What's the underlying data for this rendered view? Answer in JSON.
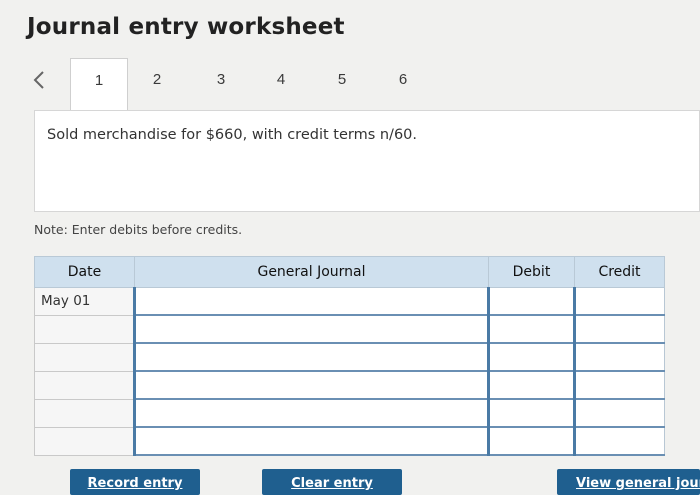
{
  "page": {
    "title": "Journal entry worksheet"
  },
  "tabs": {
    "items": [
      {
        "label": "1"
      },
      {
        "label": "2"
      },
      {
        "label": "3"
      },
      {
        "label": "4"
      },
      {
        "label": "5"
      },
      {
        "label": "6"
      }
    ],
    "active_index": 0
  },
  "question": {
    "text": "Sold merchandise for $660, with credit terms n/60."
  },
  "note": {
    "text": "Note: Enter debits before credits."
  },
  "journal": {
    "columns": [
      "Date",
      "General Journal",
      "Debit",
      "Credit"
    ],
    "rows": [
      {
        "date": "May 01",
        "account": "",
        "debit": "",
        "credit": ""
      },
      {
        "date": "",
        "account": "",
        "debit": "",
        "credit": ""
      },
      {
        "date": "",
        "account": "",
        "debit": "",
        "credit": ""
      },
      {
        "date": "",
        "account": "",
        "debit": "",
        "credit": ""
      },
      {
        "date": "",
        "account": "",
        "debit": "",
        "credit": ""
      },
      {
        "date": "",
        "account": "",
        "debit": "",
        "credit": ""
      }
    ]
  },
  "buttons": {
    "record": "Record entry",
    "clear": "Clear entry",
    "view": "View general journa"
  },
  "colors": {
    "header_bg": "#cfe0ee",
    "button_bg": "#1f5f8f",
    "input_accent": "#4a7aa5"
  },
  "icons": {
    "prev": "chevron-left-icon"
  }
}
